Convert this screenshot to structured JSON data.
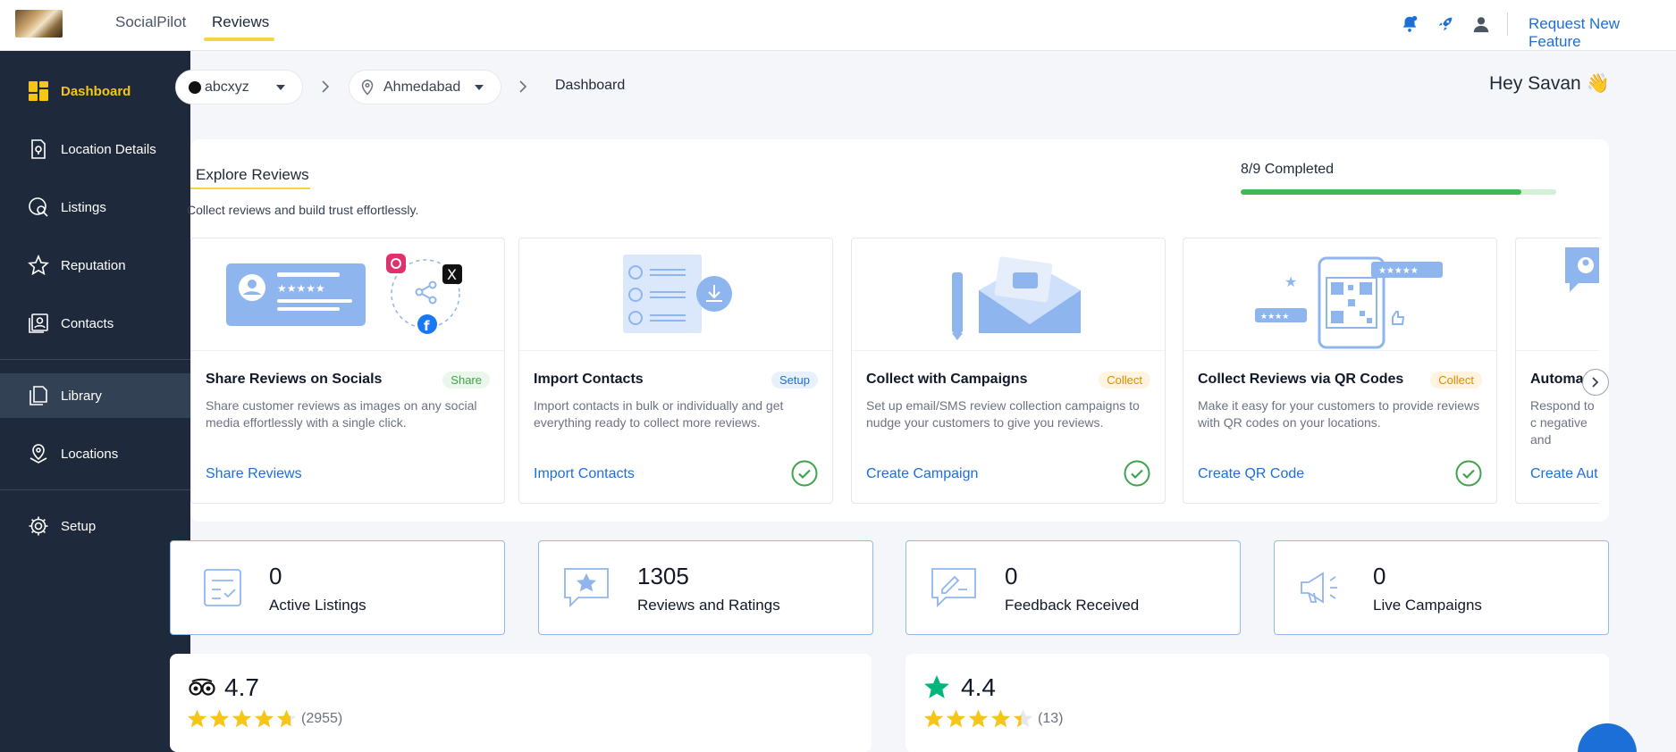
{
  "topbar": {
    "tabs": [
      {
        "label": "SocialPilot"
      },
      {
        "label": "Reviews"
      }
    ],
    "request_feature_label": "Request New Feature"
  },
  "sidebar": {
    "items": [
      {
        "label": "Dashboard",
        "icon": "dashboard-icon",
        "active": true
      },
      {
        "label": "Location Details",
        "icon": "location-details-icon"
      },
      {
        "label": "Listings",
        "icon": "listings-icon"
      },
      {
        "label": "Reputation",
        "icon": "star-icon"
      },
      {
        "label": "Contacts",
        "icon": "contacts-icon"
      },
      {
        "label": "Library",
        "icon": "library-icon"
      },
      {
        "label": "Locations",
        "icon": "locations-icon"
      },
      {
        "label": "Setup",
        "icon": "gear-icon"
      }
    ]
  },
  "breadcrumb": {
    "brand": "abcxyz",
    "location": "Ahmedabad",
    "page": "Dashboard"
  },
  "greeting": "Hey Savan 👋",
  "explore": {
    "title": "Explore Reviews",
    "subtitle": "Collect reviews and build trust effortlessly.",
    "progress_label": "8/9 Completed",
    "progress_fraction": 0.889,
    "cards": [
      {
        "title": "Share Reviews on Socials",
        "badge": "Share",
        "desc": "Share customer reviews as images on any social media effortlessly with a single click.",
        "action": "Share Reviews",
        "completed": false
      },
      {
        "title": "Import Contacts",
        "badge": "Setup",
        "desc": "Import contacts in bulk or individually and get everything ready to collect more reviews.",
        "action": "Import Contacts",
        "completed": true
      },
      {
        "title": "Collect with Campaigns",
        "badge": "Collect",
        "desc": "Set up email/SMS review collection campaigns to nudge your customers to give you reviews.",
        "action": "Create Campaign",
        "completed": true
      },
      {
        "title": "Collect Reviews via QR Codes",
        "badge": "Collect",
        "desc": "Make it easy for your customers to provide reviews with QR codes on your locations.",
        "action": "Create QR Code",
        "completed": true
      },
      {
        "title": "Automa",
        "badge": "",
        "desc": "Respond to c negative and",
        "action": "Create Aut",
        "completed": false
      }
    ]
  },
  "stats": [
    {
      "value": "0",
      "label": "Active Listings"
    },
    {
      "value": "1305",
      "label": "Reviews and Ratings"
    },
    {
      "value": "0",
      "label": "Feedback Received"
    },
    {
      "value": "0",
      "label": "Live Campaigns"
    }
  ],
  "ratings": [
    {
      "source_icon": "tripadvisor-icon",
      "score": "4.7",
      "count": "(2955)",
      "stars": 4.7,
      "star_color": "#f5c518"
    },
    {
      "source_icon": "trustpilot-icon",
      "score": "4.4",
      "count": "(13)",
      "stars": 4.4,
      "star_color": "#f5c518"
    }
  ],
  "colors": {
    "accent_yellow": "#f5d442",
    "link_blue": "#1d6fd8",
    "sidebar_bg": "#1e293b",
    "progress_green": "#3fb950"
  }
}
